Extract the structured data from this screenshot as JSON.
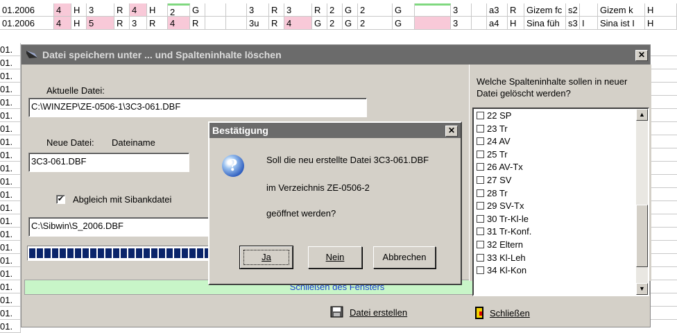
{
  "spreadsheet": {
    "rows": [
      [
        "01.2006",
        "4",
        "H",
        "3",
        "R",
        "4",
        "H",
        "2",
        "G",
        "",
        "",
        "3",
        "R",
        "3",
        "R",
        "2",
        "G",
        "2",
        "G",
        "",
        "3",
        "",
        "a3",
        "R",
        "Gizem fc",
        "s2",
        "",
        "Gizem k",
        "H"
      ],
      [
        "01.2006",
        "4",
        "H",
        "5",
        "R",
        "3",
        "R",
        "4",
        "R",
        "",
        "",
        "3u",
        "R",
        "4",
        "G",
        "2",
        "G",
        "2",
        "G",
        "",
        "3",
        "",
        "a4",
        "H",
        "Sina füh",
        "s3",
        "I",
        "Sina ist I",
        "H"
      ]
    ],
    "left_col_label": "01."
  },
  "main_dialog": {
    "title": "Datei speichern unter ...  und Spalteninhalte löschen",
    "current_file_label": "Aktuelle Datei:",
    "current_file_value": "C:\\WINZEP\\ZE-0506-1\\3C3-061.DBF",
    "new_file_label": "Neue Datei:",
    "filename_label": "Dateiname",
    "new_file_value": "3C3-061.DBF",
    "sync_checkbox_label": "Abgleich mit Sibankdatei",
    "sync_checkbox_checked": true,
    "sibank_path": "C:\\Sibwin\\S_2006.DBF",
    "status_text": "Schließen des Fensters",
    "create_button": "Datei erstellen",
    "close_button": "Schließen",
    "close_x": "✕"
  },
  "column_panel": {
    "question": "Welche Spalteninhalte sollen in neuer Datei gelöscht werden?",
    "items": [
      "22 SP",
      "23 Tr",
      "24 AV",
      "25 Tr",
      "26 AV-Tx",
      "27 SV",
      "28 Tr",
      "29 SV-Tx",
      "30 Tr-Kl-le",
      "31 Tr-Konf.",
      "32 Eltern",
      "33 Kl-Leh",
      "34 Kl-Kon"
    ]
  },
  "confirm_dialog": {
    "title": "Bestätigung",
    "line1": "Soll die neu erstellte Datei 3C3-061.DBF",
    "line2": "im Verzeichnis ZE-0506-2",
    "line3": "geöffnet werden?",
    "yes": "Ja",
    "no": "Nein",
    "cancel": "Abbrechen",
    "close_x": "✕",
    "icon": "question-icon"
  },
  "colors": {
    "pink_cell": "#f8c9d8",
    "status_bar": "#c8f5c8",
    "status_text": "#1b3fd4",
    "titlebar": "#6b6b6b",
    "progress": "#0a246a"
  }
}
